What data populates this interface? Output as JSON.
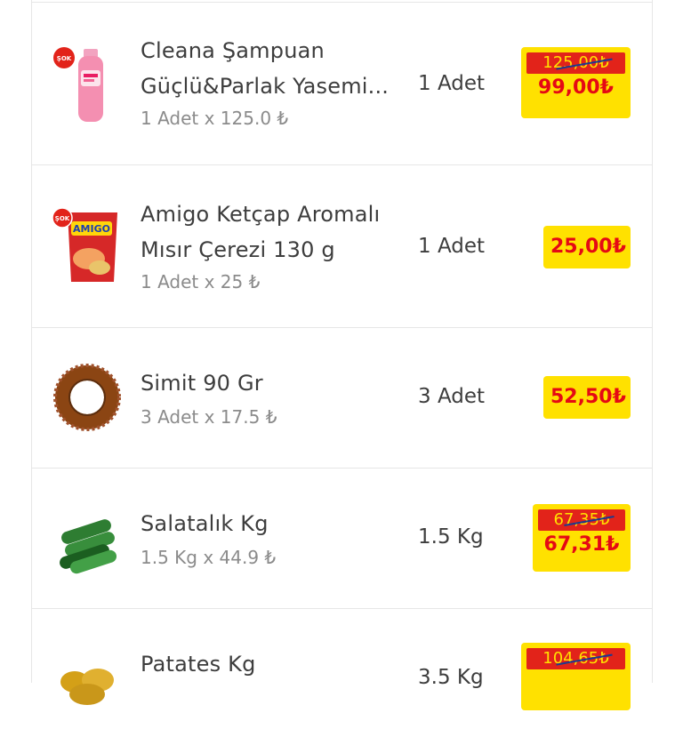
{
  "items": [
    {
      "name_line1": "Cleana Şampuan",
      "name_line2": "Güçlü&Parlak Yasemi...",
      "unit_price": "1 Adet x 125.0 ₺",
      "quantity": "1 Adet",
      "old_price": "125,00₺",
      "price": "99,00₺",
      "image_icon": "shampoo-bottle-icon",
      "badge_text": "ŞOK"
    },
    {
      "name_line1": "Amigo Ketçap Aromalı",
      "name_line2": "Mısır Çerezi 130 g",
      "unit_price": "1 Adet x 25 ₺",
      "quantity": "1 Adet",
      "price": "25,00₺",
      "image_icon": "snack-bag-icon",
      "badge_text": "ŞOK",
      "brand_text": "AMIGO"
    },
    {
      "name_line1": "Simit 90 Gr",
      "unit_price": "3 Adet x 17.5 ₺",
      "quantity": "3 Adet",
      "price": "52,50₺",
      "image_icon": "simit-bread-icon"
    },
    {
      "name_line1": "Salatalık Kg",
      "unit_price": "1.5 Kg x 44.9 ₺",
      "quantity": "1.5 Kg",
      "old_price": "67,35₺",
      "price": "67,31₺",
      "image_icon": "cucumber-icon"
    },
    {
      "name_line1": "Patates Kg",
      "quantity": "3.5 Kg",
      "old_price": "104,65₺",
      "image_icon": "potato-icon"
    }
  ],
  "colors": {
    "price_bg": "#ffe100",
    "price_text": "#e50914",
    "old_price_bg": "#e2231a",
    "strike": "#1a3b8f"
  }
}
